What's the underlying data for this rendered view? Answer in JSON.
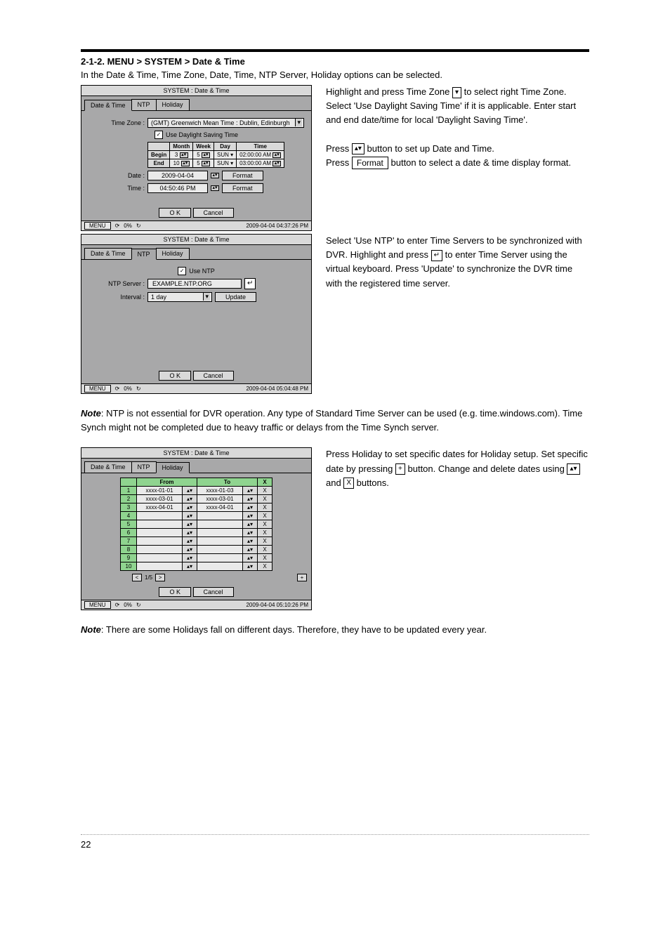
{
  "heading": "2-1-2. MENU > SYSTEM > Date & Time",
  "intro": "In the Date & Time, Time Zone, Date, Time, NTP Server, Holiday options can be selected.",
  "tabs": [
    "Date & Time",
    "NTP",
    "Holiday"
  ],
  "buttons": {
    "ok": "O K",
    "cancel": "Cancel"
  },
  "status": {
    "menu": "MENU",
    "percent": "0%"
  },
  "win1": {
    "title": "SYSTEM : Date & Time",
    "tz_label": "Time Zone :",
    "tz_value": "(GMT) Greenwich Mean Time : Dublin, Edinburgh",
    "dst_label": "Use Daylight Saving Time",
    "dst_headers": [
      "Month",
      "Week",
      "Day",
      "Time"
    ],
    "dst_rows": [
      {
        "label": "Begin",
        "month": "3",
        "week": "5",
        "day": "SUN",
        "time": "02:00:00 AM"
      },
      {
        "label": "End",
        "month": "10",
        "week": "5",
        "day": "SUN",
        "time": "03:00:00 AM"
      }
    ],
    "date_label": "Date :",
    "date_value": "2009-04-04",
    "time_label": "Time :",
    "time_value": "04:50:46 PM",
    "format_btn": "Format",
    "status_time": "2009-04-04 04:37:26 PM"
  },
  "win2": {
    "title": "SYSTEM : Date & Time",
    "use_ntp": "Use NTP",
    "server_label": "NTP Server :",
    "server_value": "EXAMPLE.NTP.ORG",
    "interval_label": "Interval :",
    "interval_value": "1 day",
    "update_btn": "Update",
    "status_time": "2009-04-04 05:04:48 PM"
  },
  "win3": {
    "title": "SYSTEM : Date & Time",
    "headers": [
      "From",
      "To",
      "X"
    ],
    "rows": [
      {
        "idx": "1",
        "from": "xxxx-01-01",
        "to": "xxxx-01-03"
      },
      {
        "idx": "2",
        "from": "xxxx-03-01",
        "to": "xxxx-03-01"
      },
      {
        "idx": "3",
        "from": "xxxx-04-01",
        "to": "xxxx-04-01"
      },
      {
        "idx": "4",
        "from": "",
        "to": ""
      },
      {
        "idx": "5",
        "from": "",
        "to": ""
      },
      {
        "idx": "6",
        "from": "",
        "to": ""
      },
      {
        "idx": "7",
        "from": "",
        "to": ""
      },
      {
        "idx": "8",
        "from": "",
        "to": ""
      },
      {
        "idx": "9",
        "from": "",
        "to": ""
      },
      {
        "idx": "10",
        "from": "",
        "to": ""
      }
    ],
    "page": "1/5",
    "status_time": "2009-04-04 05:10:26 PM"
  },
  "para1": {
    "a": "Highlight and press Time Zone",
    "b": "to select right Time Zone.",
    "c": "Select 'Use Daylight Saving Time' if it is applicable. Enter start and end date/time for local 'Daylight Saving Time'.",
    "d": "Press",
    "e": "button to set up Date and Time.",
    "f": "Press",
    "g": "button to select a date & time display format."
  },
  "para2": {
    "a": "Select 'Use NTP' to enter Time Servers to be synchronized with DVR. Highlight and press",
    "b": "to enter Time Server using the virtual keyboard. Press 'Update' to synchronize the DVR time with the registered time server."
  },
  "para3": {
    "a": "Press Holiday to set specific dates for Holiday setup. Set specific date by pressing",
    "b": "button. Change and delete dates using",
    "c": "and",
    "d": "buttons."
  },
  "notes": {
    "label": "Note",
    "ntp": ": NTP is not essential for DVR operation. Any type of Standard Time Server can be used (e.g. time.windows.com). Time Synch might not be completed due to heavy traffic or delays from the Time Synch server.",
    "holiday": ": There are some Holidays fall on different days. Therefore, they have to be updated every year."
  },
  "page_number": "22"
}
